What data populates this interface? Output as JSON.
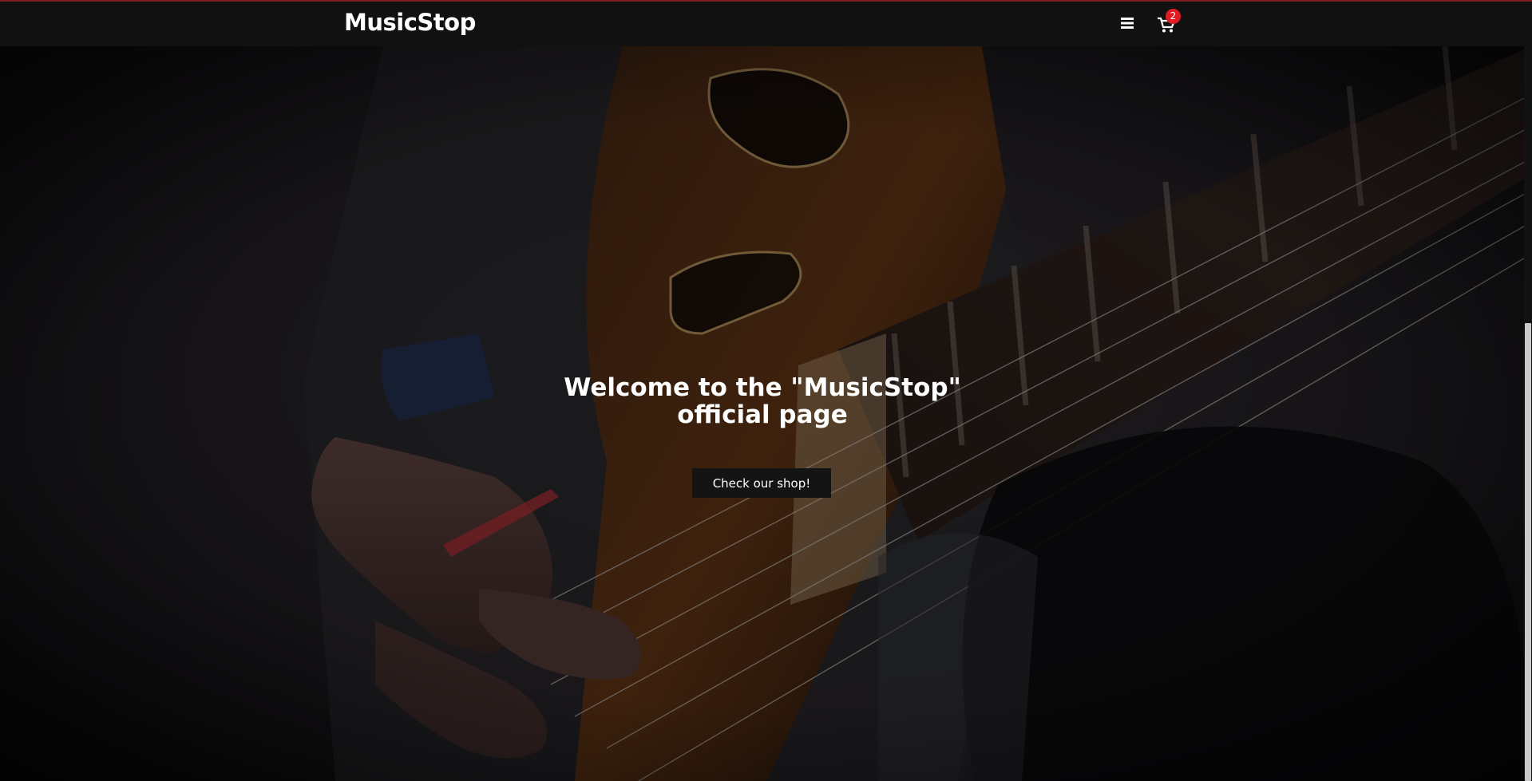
{
  "header": {
    "brand": "MusicStop",
    "menu_icon": "hamburger-menu-icon",
    "cart_icon": "shopping-cart-icon",
    "cart_count": "2"
  },
  "hero": {
    "title": "Welcome to the \"MusicStop\" official page",
    "cta_label": "Check our shop!",
    "background_image": "guitarist-playing-electric-guitar"
  },
  "colors": {
    "navbar_bg": "#111111",
    "top_accent": "#7a1f24",
    "badge": "#e31b23",
    "text": "#ffffff",
    "button_bg": "#141414"
  }
}
